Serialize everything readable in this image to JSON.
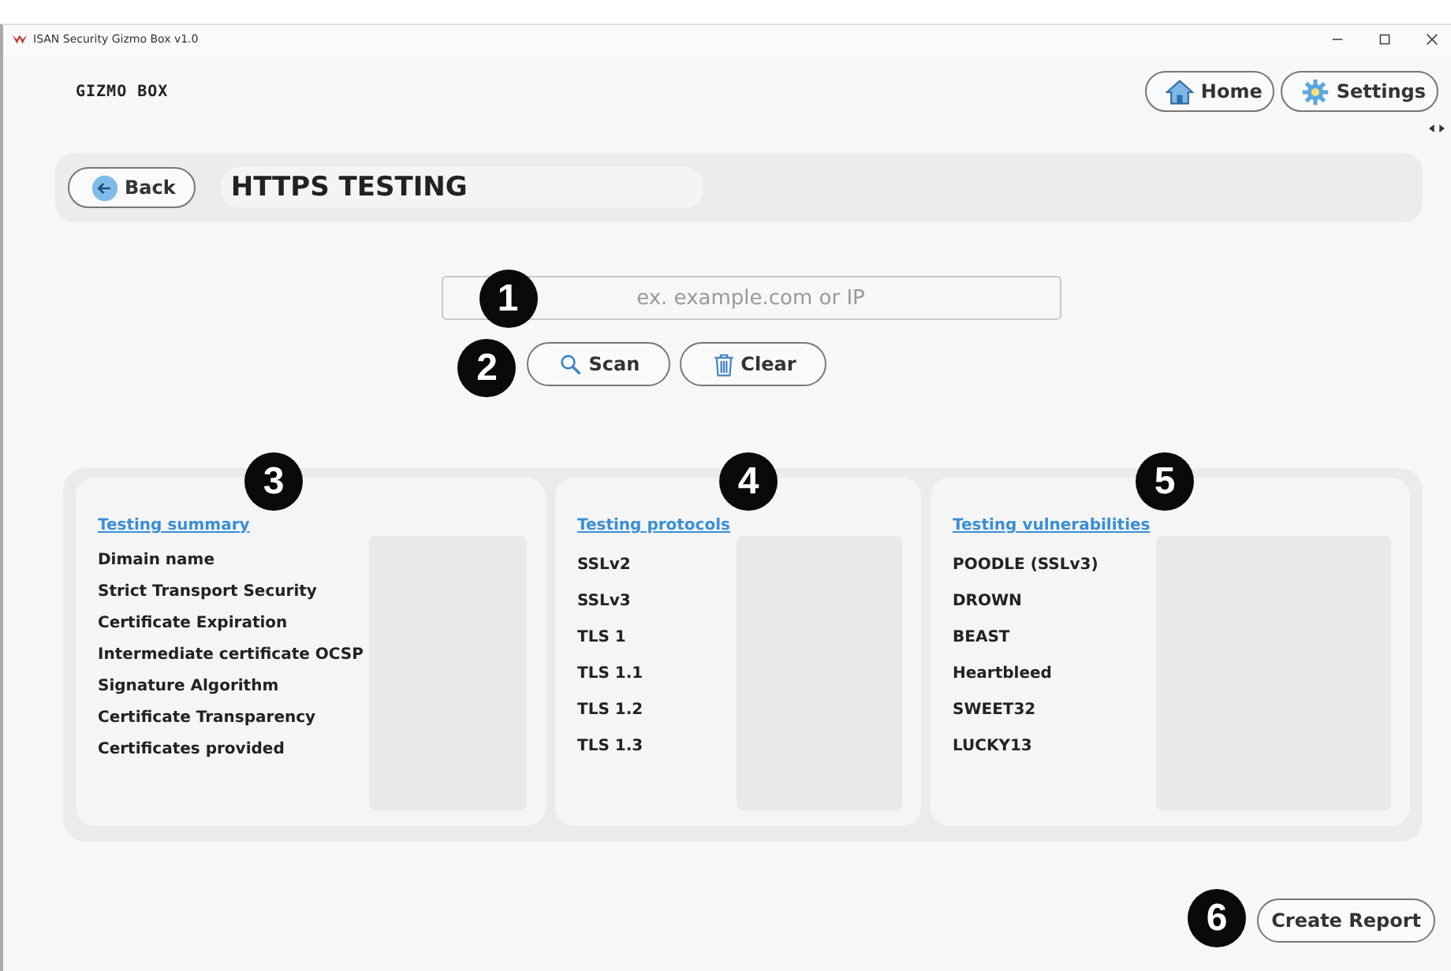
{
  "window": {
    "title": "ISAN Security Gizmo Box v1.0"
  },
  "header": {
    "logo": "GIZMO BOX",
    "buttons": [
      {
        "label": "Home",
        "kind": "home"
      },
      {
        "label": "Settings",
        "kind": "settings"
      }
    ]
  },
  "page": {
    "back": "Back",
    "title": "HTTPS TESTING"
  },
  "scan": {
    "placeholder": "ex. example.com or IP",
    "buttons": [
      {
        "label": "Scan",
        "kind": "scan"
      },
      {
        "label": "Clear",
        "kind": "clear"
      }
    ]
  },
  "panels": [
    {
      "heading": "Testing summary",
      "marker": "3",
      "items": [
        "Dimain name",
        "Strict Transport Security",
        "Certificate Expiration",
        "Intermediate certificate OCSP",
        "Signature Algorithm",
        "Certificate Transparency",
        "Certificates provided"
      ]
    },
    {
      "heading": "Testing protocols",
      "marker": "4",
      "items": [
        "SSLv2",
        "SSLv3",
        "TLS 1",
        "TLS 1.1",
        "TLS 1.2",
        "TLS 1.3"
      ]
    },
    {
      "heading": "Testing vulnerabilities",
      "marker": "5",
      "items": [
        "POODLE (SSLv3)",
        "DROWN",
        "BEAST",
        "Heartbleed",
        "SWEET32",
        "LUCKY13"
      ]
    }
  ],
  "markers": {
    "input": "1",
    "buttons": "2",
    "report": "6"
  },
  "report_button": "Create Report"
}
